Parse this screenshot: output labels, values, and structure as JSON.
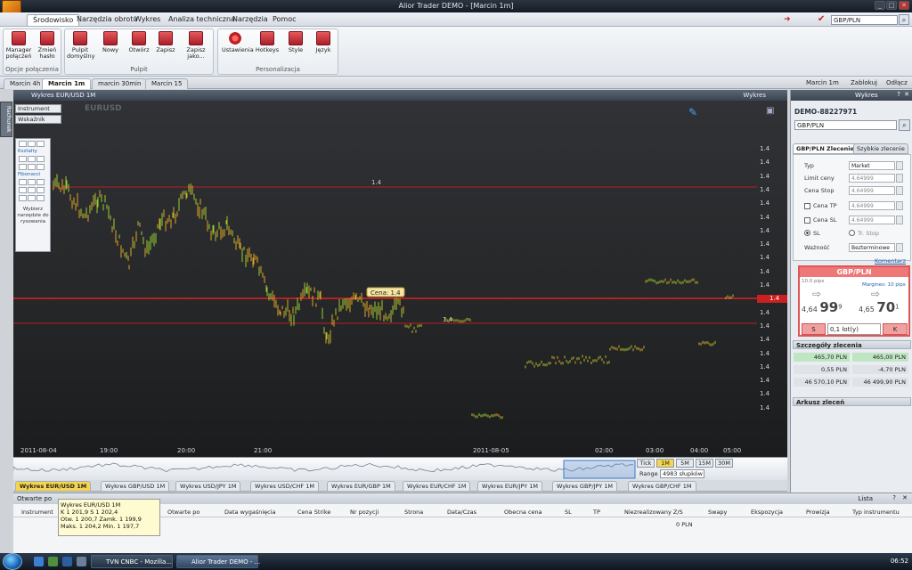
{
  "app": {
    "title": "Alior Trader DEMO - [Marcin 1m]"
  },
  "menu": [
    "Środowisko",
    "Narzędzia obrotu",
    "Wykres",
    "Analiza techniczna",
    "Narzędzia",
    "Pomoc"
  ],
  "ribbon": {
    "groups": [
      {
        "label": "Opcje połączenia",
        "buttons": [
          "Manager połączeń",
          "Zmień hasło"
        ]
      },
      {
        "label": "Pulpit",
        "buttons": [
          "Pulpit domyślny",
          "Nowy",
          "Otwórz",
          "Zapisz",
          "Zapisz jako..."
        ]
      },
      {
        "label": "Personalizacja",
        "buttons": [
          "Ustawienia",
          "Hotkeys",
          "Style",
          "Język"
        ]
      }
    ]
  },
  "topright": {
    "symbol": "GBP/PLN"
  },
  "workspace_tabs": [
    "Marcin 4h",
    "Marcin 1m",
    "marcin 30min",
    "Marcin 15"
  ],
  "workspace_links": {
    "user": "Marcin 1m",
    "lock": "Zablokuj",
    "detach": "Odłącz"
  },
  "chart_window": {
    "title": "Wykres EUR/USD 1M",
    "type_label": "Wykres",
    "instrument_dd": "Instrument",
    "indicator_dd": "Wskaźnik",
    "watermark": "EURUSD",
    "side_tab": "Rachunek",
    "tool_sections": [
      "Kształty",
      "Fibonacci"
    ],
    "tool_footer": "Wybierz narzędzie do rysowania",
    "price_ticks": [
      "1.4",
      "1.4",
      "1.4",
      "1.4",
      "1.4",
      "1.4",
      "1.4",
      "1.4",
      "1.4",
      "1.4",
      "1.4",
      "1.4",
      "1.4",
      "1.4",
      "1.4",
      "1.4",
      "1.4",
      "1.4",
      "1.4",
      "1.4"
    ],
    "last_price_label": "1.4",
    "hline_label": "1.4",
    "hline_label2": "1.4",
    "price_tag": "Cena: 1.4",
    "time_ticks": [
      "2011-08-04",
      "19:00",
      "20:00",
      "21:00",
      "2011-08-05",
      "02:00",
      "03:00",
      "04:00",
      "05:00"
    ],
    "periods": [
      "Tick",
      "1M",
      "5M",
      "15M",
      "30M"
    ],
    "selected_period": "1M",
    "range_label": "Range",
    "range_value": "4983 słupków"
  },
  "chart_tabs": [
    "Wykres EUR/USD 1M",
    "Wykres GBP/USD 1M",
    "Wykres USD/JPY 1M",
    "Wykres USD/CHF 1M",
    "Wykres EUR/GBP 1M",
    "Wykres EUR/CHF 1M",
    "Wykres EUR/JPY 1M",
    "Wykres GBP/JPY 1M",
    "Wykres GBP/CHF 1M"
  ],
  "right_panel": {
    "header": "Wykres",
    "account": "DEMO-88227971",
    "symbol": "GBP/PLN",
    "tabs": [
      "GBP/PLN Zlecenie",
      "Szybkie zlecenie"
    ],
    "form": {
      "typ_label": "Typ",
      "typ_value": "Market",
      "limit_label": "Limit ceny",
      "limit_value": "4.64999",
      "stop_label": "Cena Stop",
      "stop_value": "4.64999",
      "tp_label": "Cena TP",
      "tp_value": "4.64999",
      "sl_label": "Cena SL",
      "sl_value": "4.64999",
      "sl_radio": "SL",
      "trstop_radio": "Tr. Stop",
      "validity_label": "Ważność",
      "validity_value": "Bezterminowe",
      "comment_link": "Komentarz"
    },
    "trade": {
      "title": "GBP/PLN",
      "spread_left": "10.0 pips",
      "margin": "Margines: 10 pips",
      "bid_prefix": "4,64",
      "bid_big": "99",
      "bid_pip": "9",
      "ask_prefix": "4,65",
      "ask_big": "70",
      "ask_pip": "1",
      "sell": "S",
      "qty": "0,1 lot(y)",
      "buy": "K"
    },
    "details_title": "Szczegóły zlecenia",
    "details": [
      [
        "465,70 PLN",
        "465,00 PLN"
      ],
      [
        "0,55 PLN",
        "-4,70 PLN"
      ],
      [
        "46 570,10 PLN",
        "46 499,90 PLN"
      ]
    ],
    "sheet_title": "Arkusz zleceń"
  },
  "bottom": {
    "tab": "Otwarte po",
    "list_label": "Lista",
    "columns": [
      "Instrument",
      "Otwarte po",
      "Data wygaśnięcia",
      "Cena Strike",
      "Nr pozycji",
      "Strona",
      "Data/Czas",
      "Obecna cena",
      "SL",
      "TP",
      "Niezrealizowany Z/S",
      "Swapy",
      "Ekspozycja",
      "Prowizja",
      "Typ instrumentu"
    ],
    "pl_value": "0 PLN",
    "tooltip": [
      "Wykres EUR/USD 1M",
      "K 1 201,9   S 1 202,4",
      "Otw. 1 200,7   Zamk. 1 199,9",
      "Maks. 1 204,2   Min. 1 197,7"
    ]
  },
  "taskbar": {
    "items": [
      "TVN CNBC - Mozilla...",
      "Alior Trader DEMO - ..."
    ],
    "clock": "06:52"
  }
}
